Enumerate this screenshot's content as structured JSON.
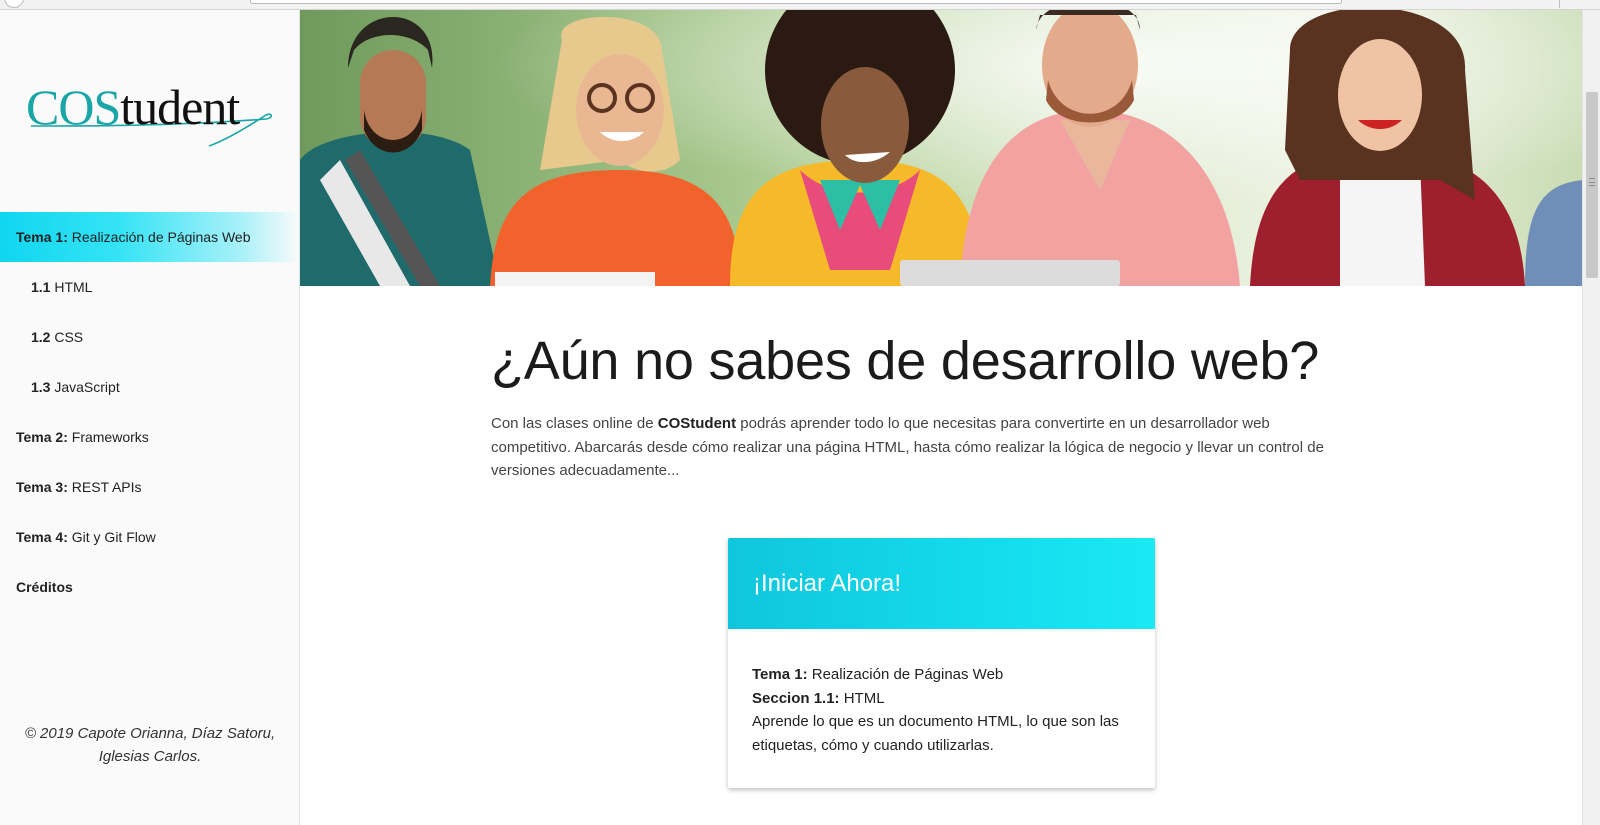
{
  "sidebar": {
    "logo": {
      "part1": "COS",
      "part2": "tudent"
    },
    "items": [
      {
        "prefix": "Tema 1:",
        "label": "Realización de Páginas Web",
        "active": true
      },
      {
        "prefix": "1.1",
        "label": "HTML"
      },
      {
        "prefix": "1.2",
        "label": "CSS"
      },
      {
        "prefix": "1.3",
        "label": "JavaScript"
      },
      {
        "prefix": "Tema 2:",
        "label": "Frameworks"
      },
      {
        "prefix": "Tema 3:",
        "label": "REST APIs"
      },
      {
        "prefix": "Tema 4:",
        "label": "Git y Git Flow"
      }
    ],
    "credits": "Créditos",
    "copyright_line1": "© 2019 Capote Orianna, Díaz Satoru,",
    "copyright_line2": "Iglesias Carlos."
  },
  "main": {
    "headline": "¿Aún no sabes de desarrollo web?",
    "intro_before": "Con las clases online de ",
    "intro_brand": "COStudent",
    "intro_after": " podrás aprender todo lo que necesitas para convertirte en un desarrollador web competitivo. Abarcarás desde cómo realizar una página HTML, hasta cómo realizar la lógica de negocio y llevar un control de versiones adecuadamente...",
    "card": {
      "title": "¡Iniciar Ahora!",
      "tema_label": "Tema 1:",
      "tema_value": "Realización de Páginas Web",
      "seccion_label": "Seccion 1.1:",
      "seccion_value": "HTML",
      "description": "Aprende lo que es un documento HTML, lo que son las etiquetas, cómo y cuando utilizarlas."
    }
  },
  "colors": {
    "accent": "#10d6ef",
    "logo_teal": "#1aa5a6"
  },
  "icons": {
    "scroll_thumb": "scrollbar-grip-icon"
  }
}
